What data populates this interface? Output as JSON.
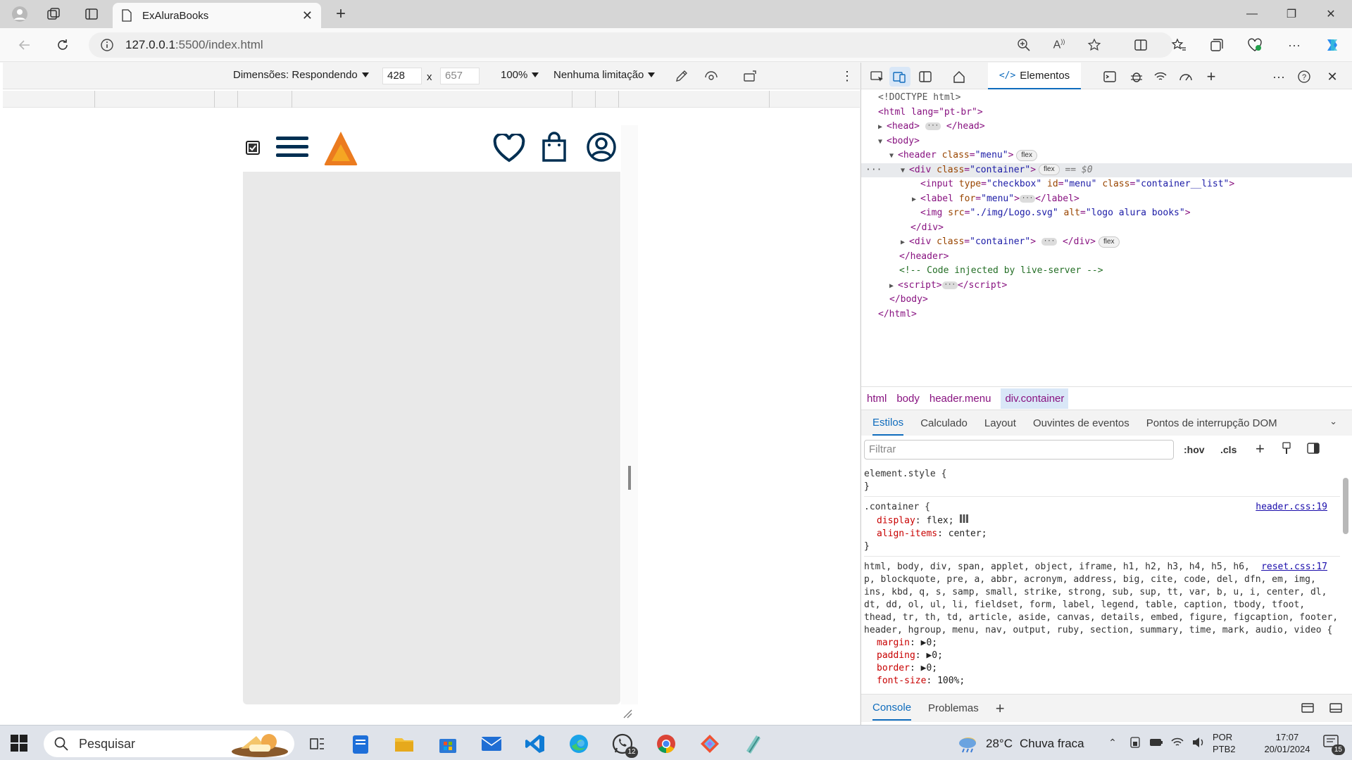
{
  "browser": {
    "tab_title": "ExAluraBooks",
    "url_host": "127.0.0.1",
    "url_path": ":5500/index.html"
  },
  "device_toolbar": {
    "dimensions_label": "Dimensões: Respondendo",
    "width": "428",
    "times": "x",
    "height": "657",
    "zoom": "100%",
    "throttle": "Nenhuma limitação"
  },
  "devtools": {
    "elements_tab": "Elementos",
    "dom": {
      "doctype": "<!DOCTYPE html>",
      "html_open": "<html lang=\"pt-br\">",
      "comment": "<!-- Code injected by live-server -->",
      "selected_marker": "== $0",
      "flex": "flex",
      "img_src": "./img/Logo.svg",
      "img_alt": "logo alura books",
      "input_type": "checkbox",
      "input_id": "menu",
      "input_class": "container__list",
      "label_for": "menu",
      "header_class": "menu",
      "div_class": "container"
    },
    "breadcrumbs": [
      "html",
      "body",
      "header.menu",
      "div.container"
    ],
    "styles_tabs": [
      "Estilos",
      "Calculado",
      "Layout",
      "Ouvintes de eventos",
      "Pontos de interrupção DOM"
    ],
    "filter_placeholder": "Filtrar",
    "hov": ":hov",
    "cls": ".cls",
    "rules": {
      "element_style": "element.style {",
      "close": "}",
      "container_selector": ".container {",
      "container_src": "header.css:19",
      "display_name": "display",
      "display_value": "flex;",
      "align_name": "align-items",
      "align_value": "center;",
      "reset_selector": "html, body, div, span, applet, object, iframe, h1, h2, h3, h4, h5, h6, p, blockquote, pre, a, abbr, acronym, address, big, cite, code, del, dfn, em, img, ins, kbd, q, s, samp, small, strike, strong, sub, sup, tt, var, b, u, i, center, dl, dt, dd, ol, ul, li, fieldset, form, label, legend, table, caption, tbody, tfoot, thead, tr, th, td, article, aside, canvas, details, embed, figure, figcaption, footer, header, hgroup, menu, nav, output, ruby, section, summary, time, mark, audio, video {",
      "reset_src": "reset.css:17",
      "margin_name": "margin",
      "margin_value": "0;",
      "padding_name": "padding",
      "padding_value": "0;",
      "border_name": "border",
      "border_value": "0;",
      "font_size_name": "font-size",
      "font_size_value": "100%;"
    },
    "drawer_tabs": [
      "Console",
      "Problemas"
    ]
  },
  "taskbar": {
    "search_placeholder": "Pesquisar",
    "whatsapp_badge": "12",
    "weather_temp": "28°C",
    "weather_desc": "Chuva fraca",
    "lang_1": "POR",
    "lang_2": "PTB2",
    "time": "17:07",
    "date": "20/01/2024",
    "notif_count": "15"
  },
  "colors": {
    "accent": "#0f6cbd",
    "logo_orange": "#f5a623",
    "logo_dark_orange": "#eb7b1f",
    "navy": "#002f52"
  }
}
